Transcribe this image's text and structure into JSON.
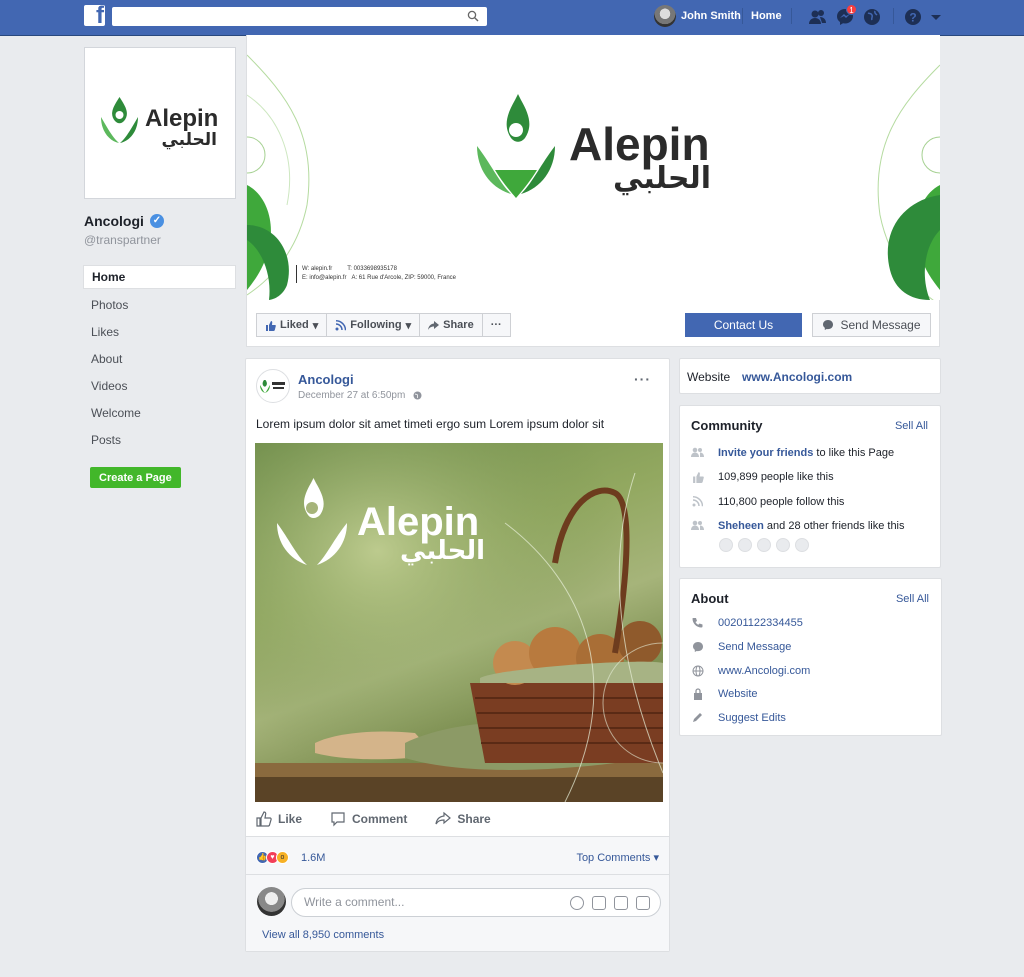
{
  "topbar": {
    "logo": "f",
    "user_name": "John Smith",
    "home_label": "Home",
    "notification_count": "1"
  },
  "profile": {
    "logo_text": "Alepin",
    "logo_arabic": "الحلبي",
    "name": "Ancologi",
    "handle": "@transpartner"
  },
  "nav": {
    "items": [
      "Home",
      "Photos",
      "Likes",
      "About",
      "Videos",
      "Welcome",
      "Posts"
    ],
    "create_page": "Create a Page"
  },
  "cover": {
    "brand": "Alepin",
    "brand_arabic": "الحلبي",
    "contact_w": "W: alepin.fr",
    "contact_e": "E: info@alepin.fr",
    "contact_t": "T: 0033698935178",
    "contact_a": "A: 61 Rue d'Arcole, ZIP: 59000, France"
  },
  "actions": {
    "liked": "Liked",
    "following": "Following",
    "share": "Share",
    "more": "···",
    "contact": "Contact Us",
    "send_message": "Send Message"
  },
  "post": {
    "author": "Ancologi",
    "time": "December 27 at 6:50pm",
    "more": "···",
    "text": "Lorem ipsum dolor sit amet timeti ergo sum Lorem ipsum dolor sit",
    "image_brand": "Alepin",
    "image_brand_arabic": "الحلبي",
    "like": "Like",
    "comment": "Comment",
    "share": "Share",
    "reaction_count": "1.6M",
    "top_comments": "Top Comments ▾",
    "comment_placeholder": "Write a comment...",
    "view_all": "View all 8,950 comments"
  },
  "website_card": {
    "label": "Website",
    "url": "www.Ancologi.com"
  },
  "community": {
    "title": "Community",
    "see_all": "Sell All",
    "invite_link": "Invite your friends",
    "invite_rest": "to like this Page",
    "likes": "109,899 people like this",
    "follows": "110,800 people follow this",
    "friend_name": "Sheheen",
    "friend_rest": "and 28 other friends like this"
  },
  "about": {
    "title": "About",
    "see_all": "Sell All",
    "phone": "00201122334455",
    "message": "Send Message",
    "website": "www.Ancologi.com",
    "website_label": "Website",
    "suggest": "Suggest Edits"
  },
  "colors": {
    "brand_blue": "#4267b2",
    "link": "#365899",
    "green": "#42b72a",
    "logo_green": "#3aa335"
  }
}
